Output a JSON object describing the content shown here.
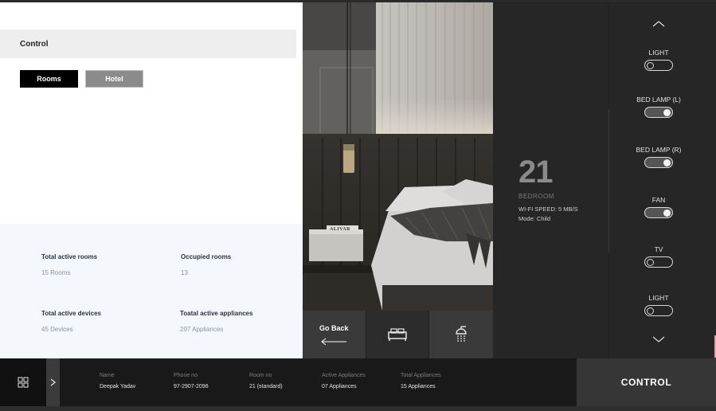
{
  "header": {
    "title": "Control"
  },
  "view_toggle": {
    "rooms_label": "Rooms",
    "hotel_label": "Hotel",
    "selected": "Rooms"
  },
  "stats": [
    {
      "title": "Total active rooms",
      "value": "15 Rooms"
    },
    {
      "title": "Occupied rooms",
      "value": "13"
    },
    {
      "title": "Total active devices",
      "value": "45 Devices"
    },
    {
      "title": "Toatal active appliances",
      "value": "207 Appliances"
    }
  ],
  "image": {
    "logo_text": "ALIVAR"
  },
  "image_controls": {
    "go_back_label": "Go Back",
    "bed_icon": "bed-icon",
    "shower_icon": "shower-icon"
  },
  "room": {
    "number": "21",
    "type": "BEDROOM",
    "wifi": "WI-FI SPEED: 5 MB/S",
    "mode": "Mode: Child"
  },
  "appliances": [
    {
      "name": "LIGHT",
      "state": "off"
    },
    {
      "name": "BED LAMP (L)",
      "state": "on"
    },
    {
      "name": "BED LAMP (R)",
      "state": "on"
    },
    {
      "name": "FAN",
      "state": "on"
    },
    {
      "name": "TV",
      "state": "off"
    },
    {
      "name": "LIGHT",
      "state": "off"
    }
  ],
  "guest": {
    "fields": [
      {
        "label": "Name",
        "value": "Deepak Yadav"
      },
      {
        "label": "Phone no",
        "value": "97-2907-2096"
      },
      {
        "label": "Room no",
        "value": "21 (standard)"
      },
      {
        "label": "Active Appliances",
        "value": "07 Appliances"
      },
      {
        "label": "Total Appliances",
        "value": "15 Appliances"
      }
    ]
  },
  "control_button": {
    "label": "CONTROL"
  },
  "colors": {
    "accent_dark": "#262626",
    "button_selected": "#000000",
    "button_unselected": "#8b8b8b"
  }
}
